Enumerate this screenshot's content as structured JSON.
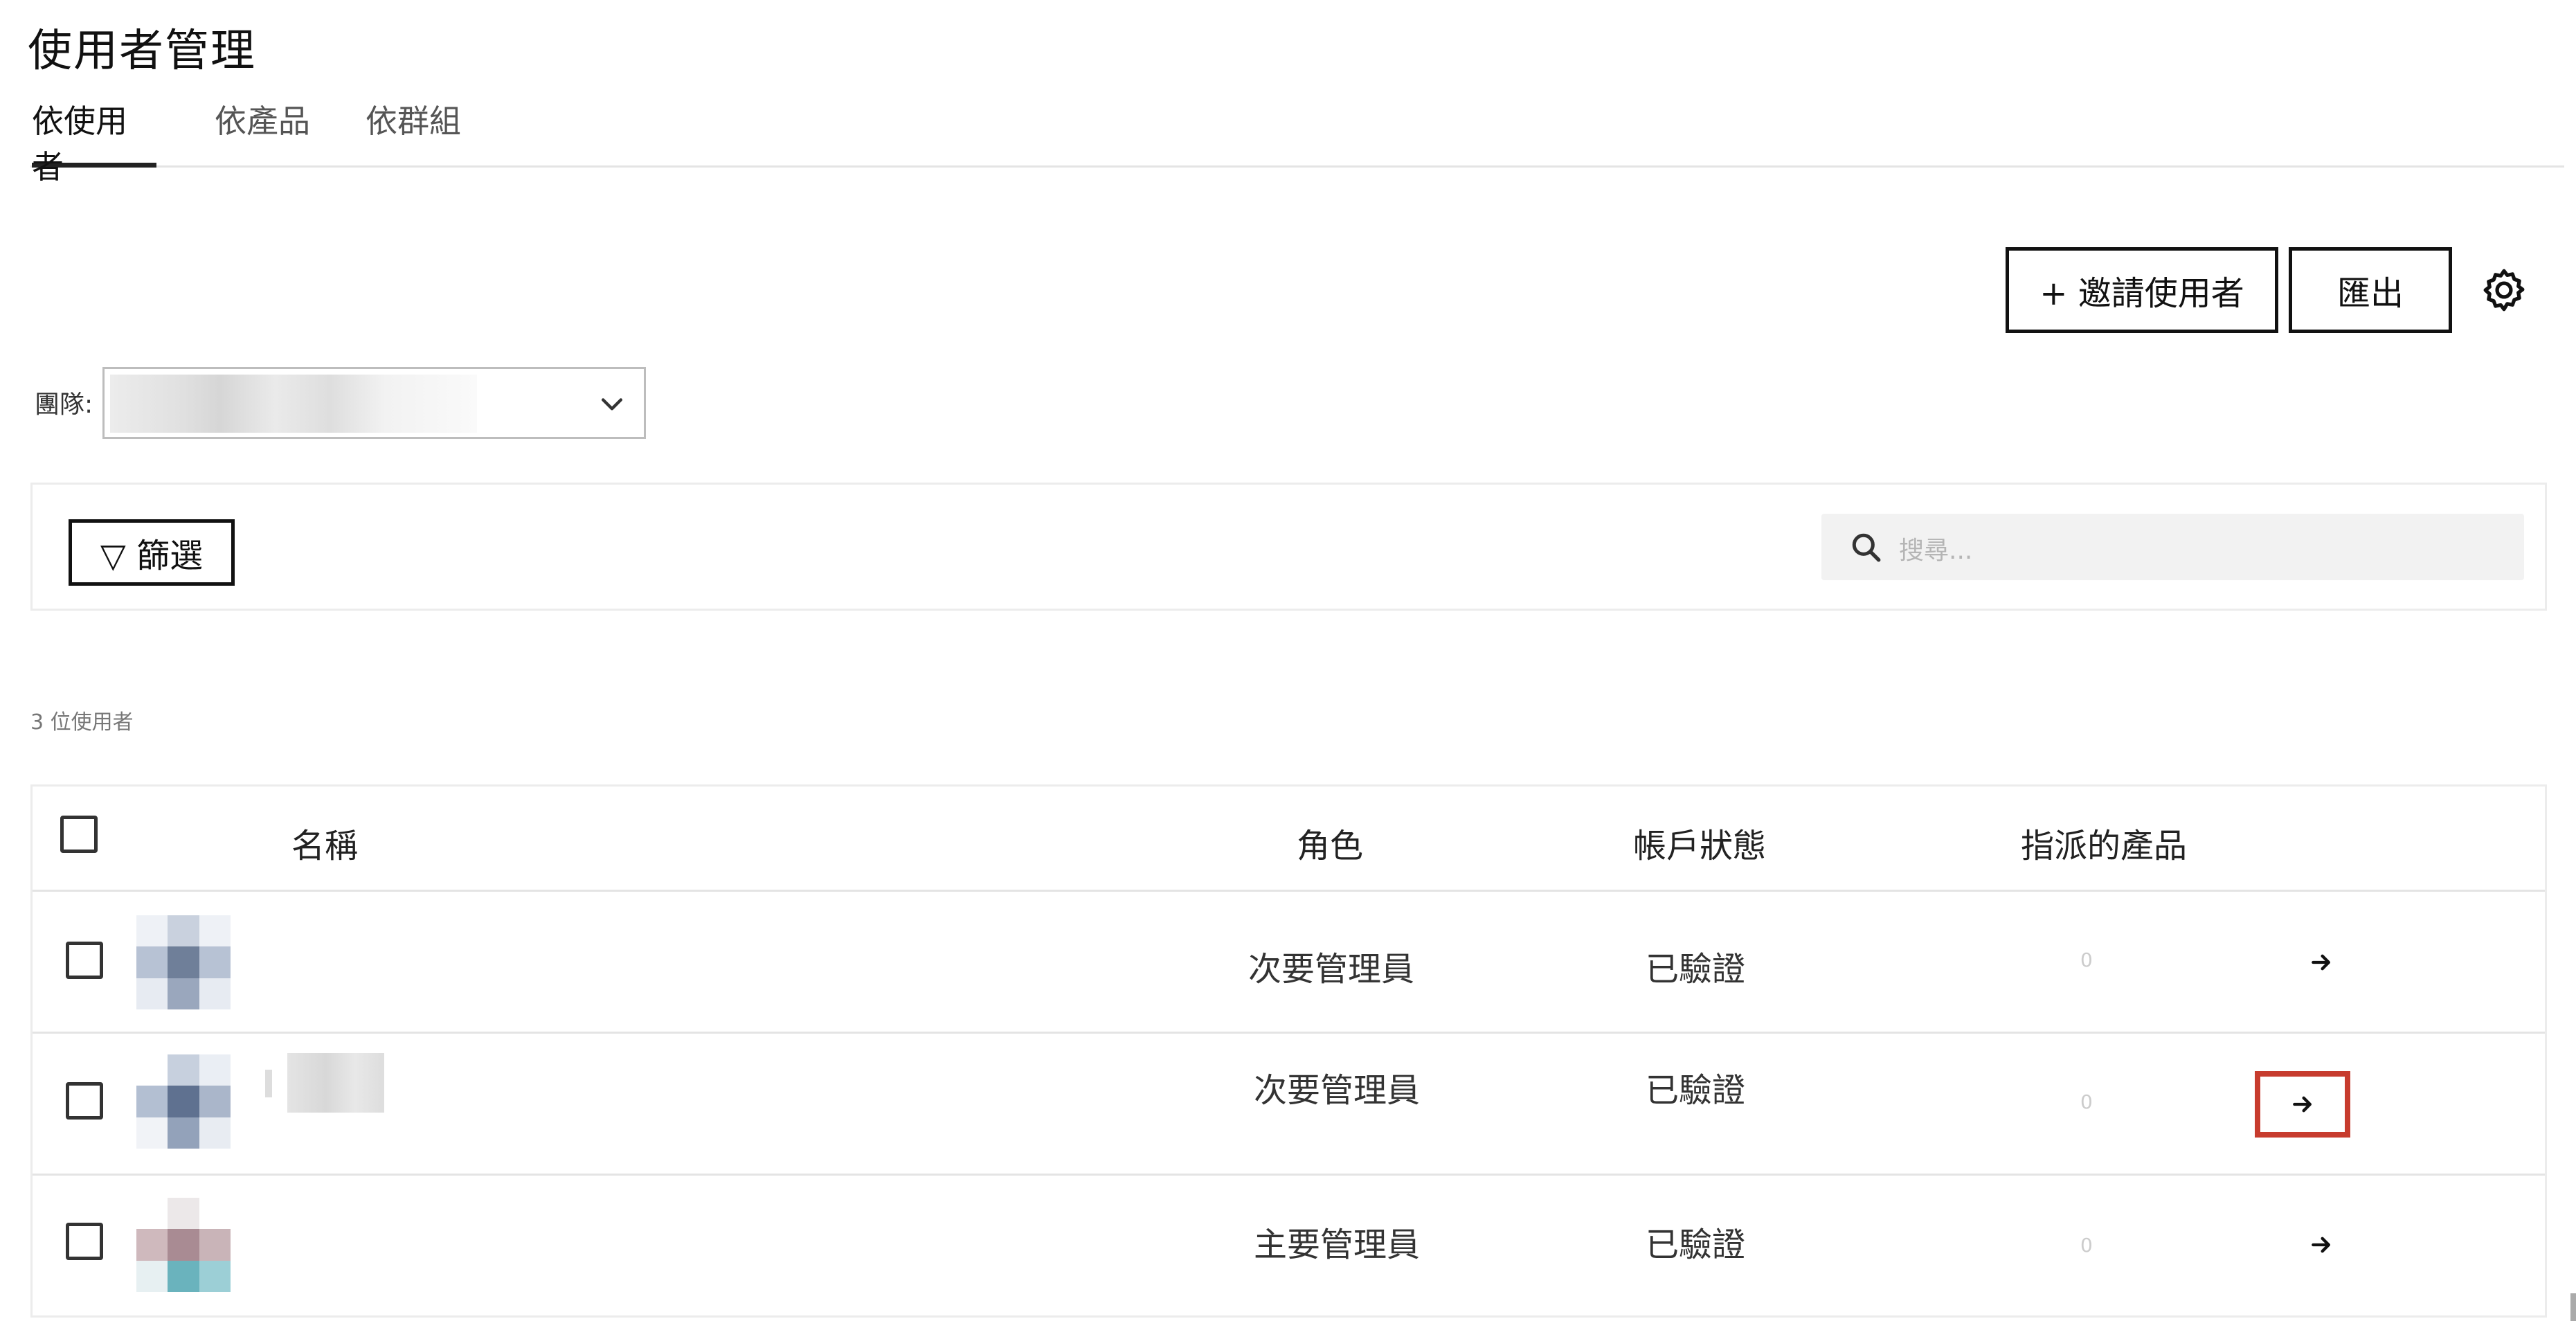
{
  "page": {
    "title": "使用者管理"
  },
  "tabs": [
    {
      "label": "依使用者",
      "active": true
    },
    {
      "label": "依產品",
      "active": false
    },
    {
      "label": "依群組",
      "active": false
    }
  ],
  "toolbar": {
    "invite_label": "+ 邀請使用者",
    "export_label": "匯出",
    "settings_icon": "gear-icon"
  },
  "group": {
    "label": "團隊:",
    "selected_value": ""
  },
  "filter": {
    "filter_label": "▽ 篩選",
    "search_placeholder": "搜尋..."
  },
  "table": {
    "count_text": "3 位使用者",
    "columns": {
      "name": "名稱",
      "role": "角色",
      "status": "帳戶狀態",
      "products": "指派的產品"
    },
    "rows": [
      {
        "role": "次要管理員",
        "status": "已驗證",
        "products": "0",
        "avatar_colors": [
          "#eef1f6",
          "#c9d1de",
          "#eef1f6",
          "#b7c2d4",
          "#6f7f99",
          "#b7c2d4",
          "#e7ebf2",
          "#9aa7bd",
          "#e7ebf2"
        ]
      },
      {
        "role": "次要管理員",
        "status": "已驗證",
        "products": "0",
        "avatar_colors": [
          "#ffffff",
          "#c7d0de",
          "#eaeef4",
          "#b3bfd2",
          "#5f7190",
          "#aab6ca",
          "#f1f3f7",
          "#93a2ba",
          "#e8ecf2"
        ]
      },
      {
        "role": "主要管理員",
        "status": "已驗證",
        "products": "0",
        "avatar_colors": [
          "#ffffff",
          "#ece8e9",
          "#ffffff",
          "#cfb9bd",
          "#a98b93",
          "#c9b4b8",
          "#e7f0f2",
          "#6ab3bd",
          "#9ccfd6"
        ]
      }
    ]
  },
  "colors": {
    "highlight": "#c73c2e",
    "border": "#111111"
  }
}
